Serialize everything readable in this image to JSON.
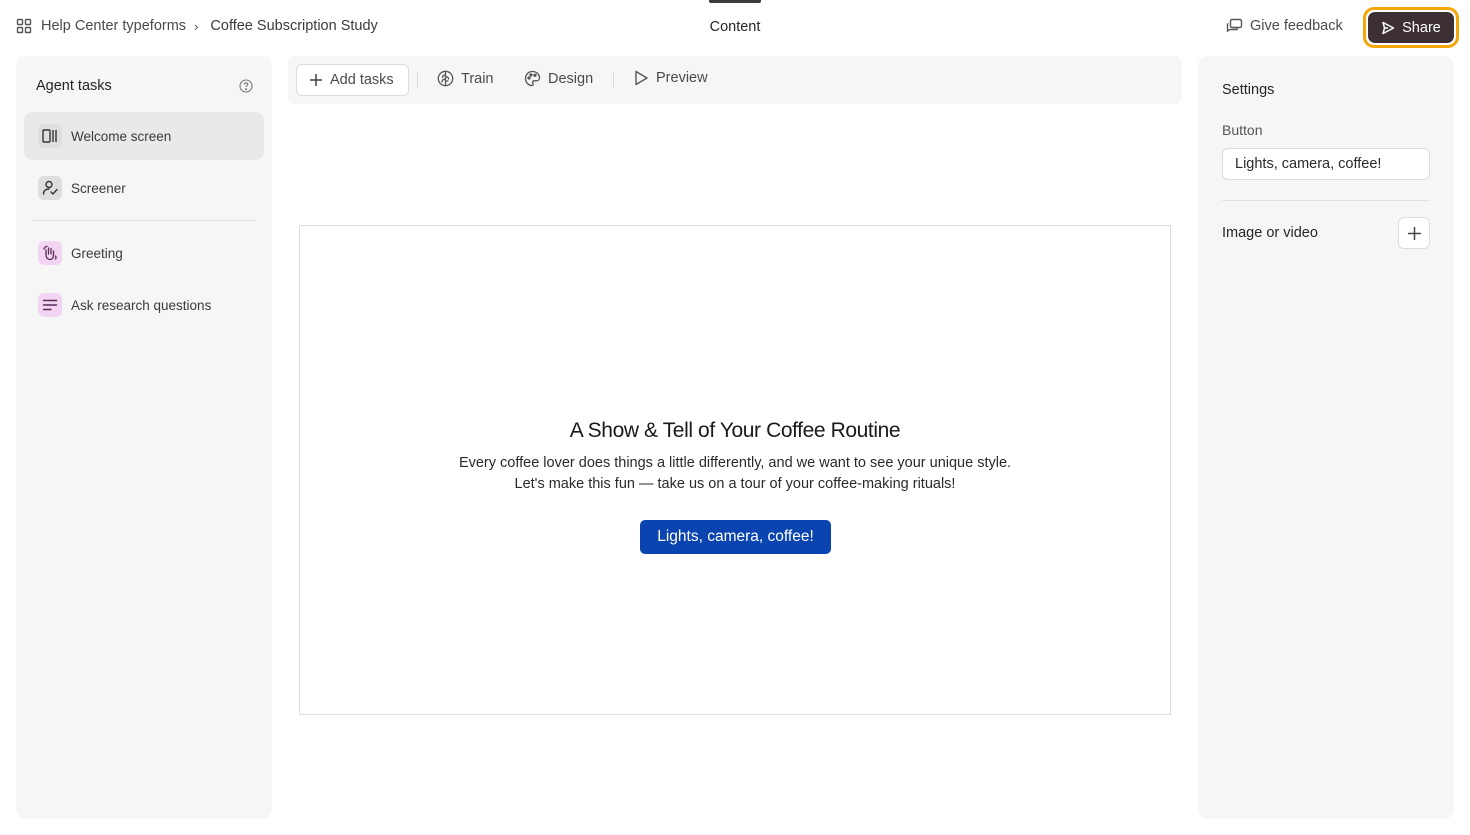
{
  "breadcrumb": {
    "workspace": "Help Center typeforms",
    "separator": "›",
    "current": "Coffee Subscription Study"
  },
  "header": {
    "active_tab": "Content",
    "feedback_label": "Give feedback",
    "share_label": "Share"
  },
  "agent_tasks": {
    "title": "Agent tasks",
    "items": [
      {
        "label": "Welcome screen",
        "icon": "welcome-screen-icon"
      },
      {
        "label": "Screener",
        "icon": "screener-icon"
      },
      {
        "label": "Greeting",
        "icon": "wave-hand-icon"
      },
      {
        "label": "Ask research questions",
        "icon": "lines-icon"
      }
    ]
  },
  "toolbar": {
    "add_tasks": "Add tasks",
    "train": "Train",
    "design": "Design",
    "preview": "Preview"
  },
  "welcome": {
    "headline": "A Show & Tell of Your Coffee Routine",
    "line1": "Every coffee lover does things a little differently, and we want to see your unique style.",
    "line2": "Let's make this fun — take us on a tour of your coffee-making rituals!",
    "button": "Lights, camera, coffee!"
  },
  "settings": {
    "title": "Settings",
    "button_label": "Button",
    "button_value": "Lights, camera, coffee!",
    "media_label": "Image or video"
  },
  "colors": {
    "accent_button": "#0a44b0",
    "share_bg": "#3d3035",
    "share_focus_ring": "#f5a70a",
    "panel_bg": "#f6f6f6"
  }
}
